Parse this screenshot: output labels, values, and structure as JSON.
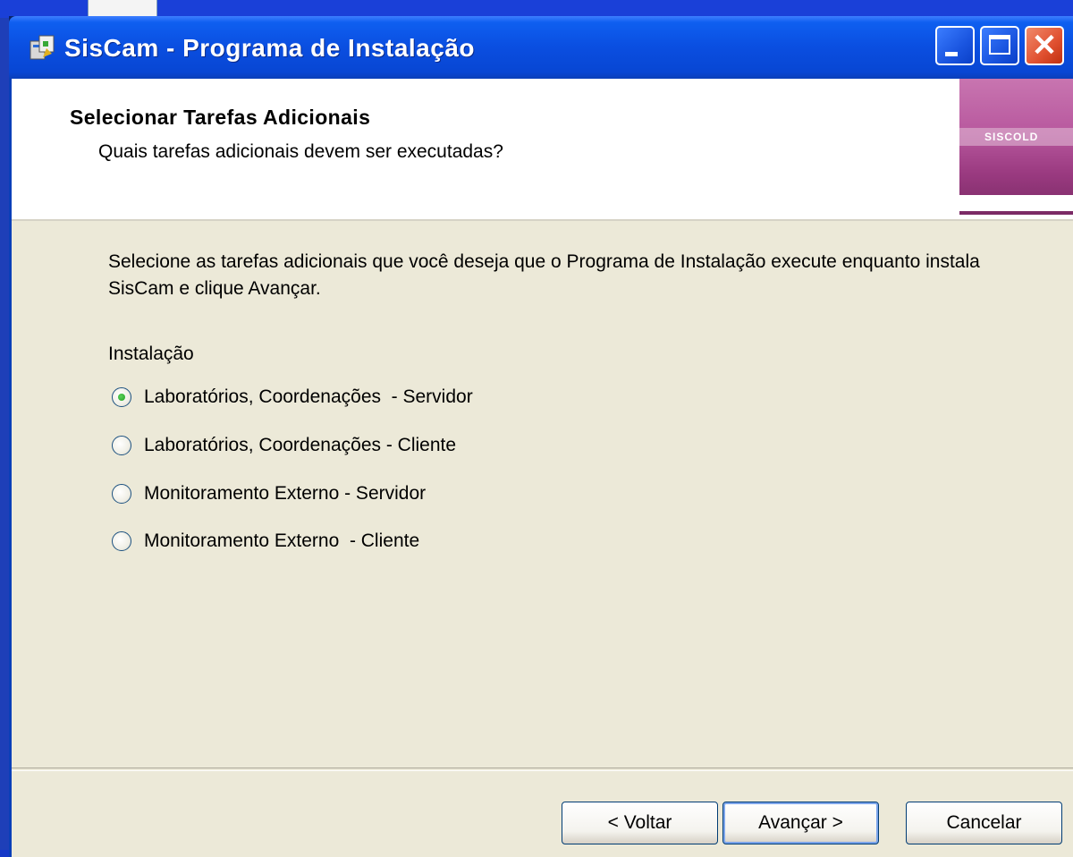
{
  "window": {
    "title": "SisCam - Programa de Instalação"
  },
  "header": {
    "title": "Selecionar Tarefas Adicionais",
    "subtitle": "Quais tarefas adicionais devem ser executadas?",
    "logo_text": "SISCOLD"
  },
  "main": {
    "intro": "Selecione as tarefas adicionais que você deseja que o Programa de Instalação execute enquanto instala SisCam e clique Avançar.",
    "group_label": "Instalação",
    "options": [
      {
        "label": "Laboratórios, Coordenações  - Servidor",
        "checked": true
      },
      {
        "label": "Laboratórios, Coordenações - Cliente",
        "checked": false
      },
      {
        "label": "Monitoramento Externo - Servidor",
        "checked": false
      },
      {
        "label": "Monitoramento Externo  - Cliente",
        "checked": false
      }
    ]
  },
  "footer": {
    "back_label": "< Voltar",
    "next_label": "Avançar >",
    "cancel_label": "Cancelar"
  },
  "colors": {
    "desktop": "#1538c8",
    "titlebar": "#0a4ee0",
    "dialog_bg": "#ece9d8",
    "radio_selected": "#21a121"
  }
}
